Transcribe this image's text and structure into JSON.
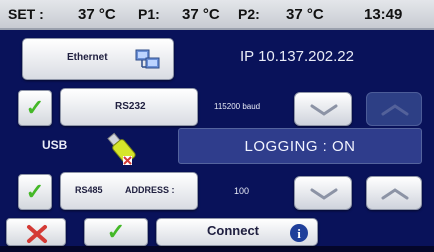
{
  "status": {
    "set_label": "SET :",
    "set_value": "37 °C",
    "p1_label": "P1:",
    "p1_value": "37 °C",
    "p2_label": "P2:",
    "p2_value": "37 °C",
    "time": "13:49"
  },
  "ethernet": {
    "button_label": "Ethernet",
    "ip_text": "IP 10.137.202.22"
  },
  "rs232": {
    "button_label": "RS232",
    "baud_text": "115200 baud",
    "enabled": true
  },
  "usb": {
    "label": "USB",
    "logging_text": "LOGGING : ON"
  },
  "rs485": {
    "button_label": "RS485",
    "address_label": "ADDRESS :",
    "address_value": "100",
    "enabled": true
  },
  "footer": {
    "connect_label": "Connect"
  },
  "colors": {
    "background": "#09125a",
    "panel": "#2f3d8c",
    "check_green": "#44b827",
    "cancel_red": "#d43a35"
  },
  "icons": [
    "network-icon",
    "usb-stick-icon",
    "check-icon",
    "cancel-icon",
    "info-icon",
    "chevron-down-icon",
    "chevron-up-icon"
  ]
}
